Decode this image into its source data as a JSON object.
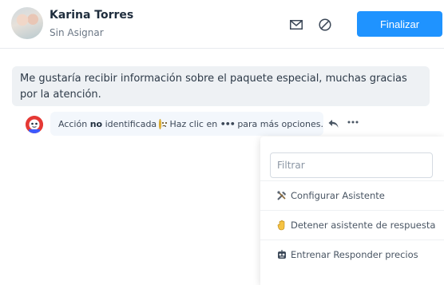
{
  "contact": {
    "name": "Karina Torres",
    "assignment": "Sin Asignar"
  },
  "header": {
    "finalize_label": "Finalizar",
    "icons": [
      "mail-icon",
      "block-icon"
    ],
    "accent_color": "#1f93ff"
  },
  "message": {
    "text": "Me gustaría recibir información sobre el paquete especial, muchas gracias por la atención."
  },
  "bot_note": {
    "prefix": "Acción",
    "bold": "no",
    "middle": "identificada",
    "suffix": ". Haz clic en",
    "dots": "•••",
    "end": "para más opciones."
  },
  "actions": {
    "icons": [
      "reply-icon",
      "more-options-icon"
    ]
  },
  "dropdown": {
    "filter_placeholder": "Filtrar",
    "items": [
      {
        "label": "Configurar Asistente",
        "icon": "tools-icon"
      },
      {
        "label": "Detener asistente de respuesta",
        "icon": "hand-icon"
      },
      {
        "label": "Entrenar Responder precios",
        "icon": "bot-icon"
      }
    ]
  }
}
